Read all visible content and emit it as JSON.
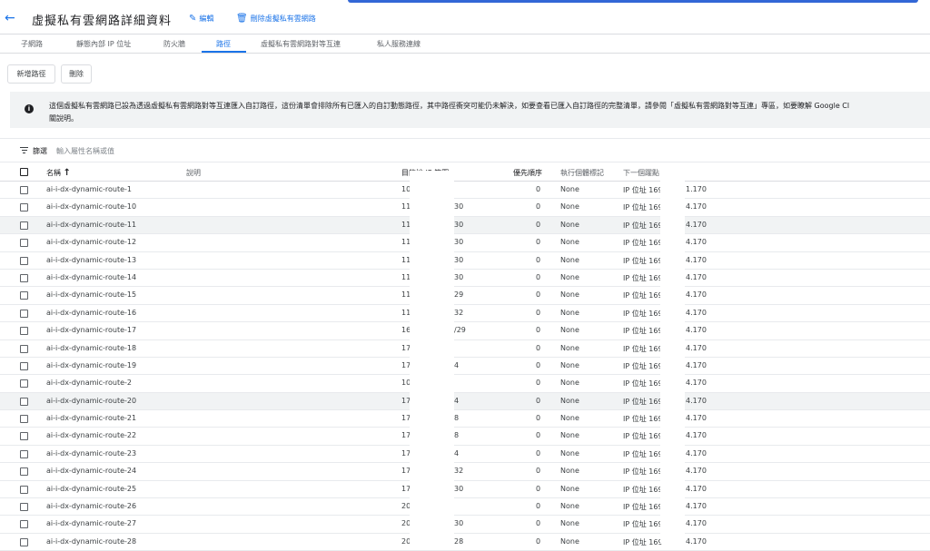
{
  "header": {
    "title": "虛擬私有雲網路詳細資料",
    "edit_label": "編輯",
    "delete_label": "刪除虛擬私有雲網路"
  },
  "tabs": [
    {
      "label": "子網路"
    },
    {
      "label": "靜態內部 IP 位址"
    },
    {
      "label": "防火牆"
    },
    {
      "label": "路徑",
      "active": true
    },
    {
      "label": "虛擬私有雲網路對等互連"
    },
    {
      "label": "私人服務連線"
    }
  ],
  "actions": {
    "new_route_label": "新增路徑",
    "delete_label": "刪除"
  },
  "notice": {
    "line1": "這個虛擬私有雲網路已設為透過虛擬私有雲網路對等互連匯入自訂路徑，這份清單會排除所有已匯入的自訂動態路徑，其中路徑衝突可能仍未解決，如要查看已匯入自訂路徑的完整清單，請參閱「虛擬私有雲網路對等互連」專區，如要瞭解 Google Cl",
    "line2": "關說明。"
  },
  "filter": {
    "label": "篩選",
    "placeholder": "輸入屬性名稱或值"
  },
  "table": {
    "columns": {
      "name": "名稱",
      "description": "說明",
      "dest": "目的地 IP 範圍",
      "priority": "優先順序",
      "tags": "執行個體標記",
      "next_hop": "下一個躍點"
    },
    "rows": [
      {
        "name": "ai-i-dx-dynamic-route-1",
        "dest1": "10",
        "dest2": "",
        "priority": "0",
        "tag": "None",
        "hop1": "IP 位址 169",
        "hop2": "1.170"
      },
      {
        "name": "ai-i-dx-dynamic-route-10",
        "dest1": "11",
        "dest2": "30",
        "priority": "0",
        "tag": "None",
        "hop1": "IP 位址 169",
        "hop2": "4.170"
      },
      {
        "name": "ai-i-dx-dynamic-route-11",
        "dest1": "11",
        "dest2": "30",
        "priority": "0",
        "tag": "None",
        "hop1": "IP 位址 169",
        "hop2": "4.170"
      },
      {
        "name": "ai-i-dx-dynamic-route-12",
        "dest1": "11",
        "dest2": "30",
        "priority": "0",
        "tag": "None",
        "hop1": "IP 位址 169",
        "hop2": "4.170"
      },
      {
        "name": "ai-i-dx-dynamic-route-13",
        "dest1": "11",
        "dest2": "30",
        "priority": "0",
        "tag": "None",
        "hop1": "IP 位址 169",
        "hop2": "4.170"
      },
      {
        "name": "ai-i-dx-dynamic-route-14",
        "dest1": "11",
        "dest2": "30",
        "priority": "0",
        "tag": "None",
        "hop1": "IP 位址 169",
        "hop2": "4.170"
      },
      {
        "name": "ai-i-dx-dynamic-route-15",
        "dest1": "11",
        "dest2": "29",
        "priority": "0",
        "tag": "None",
        "hop1": "IP 位址 169",
        "hop2": "4.170"
      },
      {
        "name": "ai-i-dx-dynamic-route-16",
        "dest1": "11",
        "dest2": "32",
        "priority": "0",
        "tag": "None",
        "hop1": "IP 位址 169",
        "hop2": "4.170"
      },
      {
        "name": "ai-i-dx-dynamic-route-17",
        "dest1": "16",
        "dest2": "/29",
        "priority": "0",
        "tag": "None",
        "hop1": "IP 位址 169",
        "hop2": "4.170"
      },
      {
        "name": "ai-i-dx-dynamic-route-18",
        "dest1": "17",
        "dest2": "",
        "priority": "0",
        "tag": "None",
        "hop1": "IP 位址 169",
        "hop2": "4.170"
      },
      {
        "name": "ai-i-dx-dynamic-route-19",
        "dest1": "17",
        "dest2": "4",
        "priority": "0",
        "tag": "None",
        "hop1": "IP 位址 169",
        "hop2": "4.170"
      },
      {
        "name": "ai-i-dx-dynamic-route-2",
        "dest1": "10",
        "dest2": "",
        "priority": "0",
        "tag": "None",
        "hop1": "IP 位址 169",
        "hop2": "4.170"
      },
      {
        "name": "ai-i-dx-dynamic-route-20",
        "dest1": "17",
        "dest2": "4",
        "priority": "0",
        "tag": "None",
        "hop1": "IP 位址 169",
        "hop2": "4.170"
      },
      {
        "name": "ai-i-dx-dynamic-route-21",
        "dest1": "17",
        "dest2": "8",
        "priority": "0",
        "tag": "None",
        "hop1": "IP 位址 169",
        "hop2": "4.170"
      },
      {
        "name": "ai-i-dx-dynamic-route-22",
        "dest1": "17",
        "dest2": "8",
        "priority": "0",
        "tag": "None",
        "hop1": "IP 位址 169",
        "hop2": "4.170"
      },
      {
        "name": "ai-i-dx-dynamic-route-23",
        "dest1": "17",
        "dest2": "4",
        "priority": "0",
        "tag": "None",
        "hop1": "IP 位址 169",
        "hop2": "4.170"
      },
      {
        "name": "ai-i-dx-dynamic-route-24",
        "dest1": "17",
        "dest2": "32",
        "priority": "0",
        "tag": "None",
        "hop1": "IP 位址 169",
        "hop2": "4.170"
      },
      {
        "name": "ai-i-dx-dynamic-route-25",
        "dest1": "17",
        "dest2": "30",
        "priority": "0",
        "tag": "None",
        "hop1": "IP 位址 169",
        "hop2": "4.170"
      },
      {
        "name": "ai-i-dx-dynamic-route-26",
        "dest1": "20",
        "dest2": "",
        "priority": "0",
        "tag": "None",
        "hop1": "IP 位址 169",
        "hop2": "4.170"
      },
      {
        "name": "ai-i-dx-dynamic-route-27",
        "dest1": "20",
        "dest2": "30",
        "priority": "0",
        "tag": "None",
        "hop1": "IP 位址 169",
        "hop2": "4.170"
      },
      {
        "name": "ai-i-dx-dynamic-route-28",
        "dest1": "20",
        "dest2": "28",
        "priority": "0",
        "tag": "None",
        "hop1": "IP 位址 169",
        "hop2": "4.170"
      }
    ]
  }
}
